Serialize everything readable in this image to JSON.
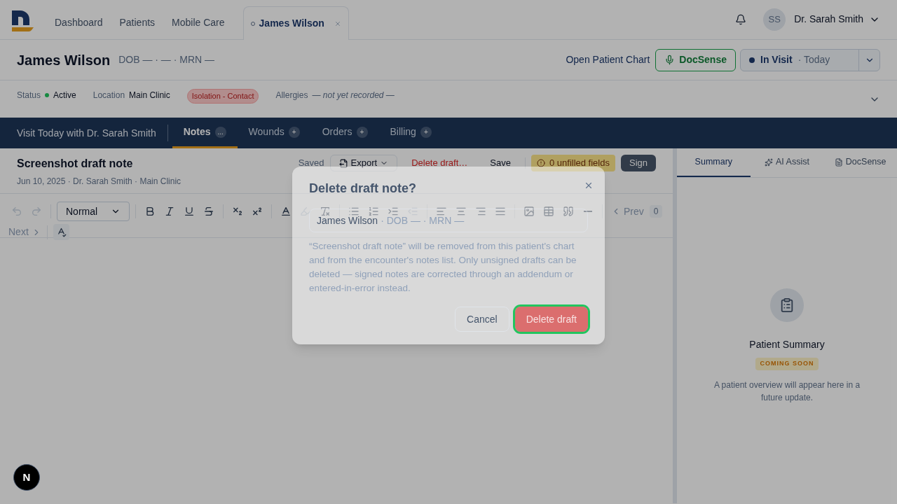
{
  "nav": {
    "tabs": [
      {
        "label": "Dashboard",
        "kind": "link",
        "selected": false
      },
      {
        "label": "Patients",
        "kind": "link",
        "selected": false
      },
      {
        "label": "Mobile Care",
        "kind": "link",
        "selected": false
      },
      {
        "label": "James Wilson",
        "kind": "patient",
        "selected": true
      }
    ],
    "user": {
      "initials": "SS",
      "name": "Dr. Sarah Smith"
    }
  },
  "patient": {
    "name": "James Wilson",
    "meta": "DOB — · — · MRN —",
    "chart_link": "Open Patient Chart",
    "docsense": "DocSense",
    "visit_status": "In Visit",
    "visit_when": "· Today"
  },
  "info": [
    {
      "kind": "status",
      "label": "Status",
      "value": "Active"
    },
    {
      "kind": "text",
      "label": "Location",
      "value": "Main Clinic"
    },
    {
      "kind": "badge",
      "value": "Isolation - Contact"
    },
    {
      "kind": "italic",
      "label": "Allergies",
      "value": "— not yet recorded —"
    }
  ],
  "encounter": {
    "title": "Visit Today with Dr. Sarah Smith",
    "tabs": [
      {
        "label": "Notes",
        "badge": "...",
        "selected": true
      },
      {
        "label": "Wounds",
        "badge": "+",
        "selected": false
      },
      {
        "label": "Orders",
        "badge": "+",
        "selected": false
      },
      {
        "label": "Billing",
        "badge": "+",
        "selected": false
      }
    ]
  },
  "note": {
    "title": "Screenshot draft note",
    "meta": "Jun 10, 2025 · Dr. Sarah Smith · Main Clinic",
    "save_state": "Saved",
    "export": "Export",
    "delete": "Delete draft…",
    "save": "Save",
    "unfilled": "0 unfilled fields",
    "sign": "Sign"
  },
  "toolbar": {
    "style": "Normal",
    "prev": "Prev",
    "count": "0",
    "next": "Next"
  },
  "side_panel": {
    "tabs": [
      {
        "label": "Summary",
        "selected": true
      },
      {
        "label": "AI Assist",
        "selected": false
      },
      {
        "label": "DocSense",
        "selected": false
      }
    ],
    "title": "Patient Summary",
    "badge": "COMING SOON",
    "text": "A patient overview will appear here in a future update."
  },
  "dialog": {
    "title": "Delete draft note?",
    "patient_name": "James Wilson",
    "patient_meta": "· DOB — · MRN —",
    "message": "“Screenshot draft note” will be removed from this patient's chart and from the encounter's notes list. Only unsigned drafts can be deleted — signed notes are corrected through an addendum or entered-in-error instead.",
    "cancel": "Cancel",
    "confirm": "Delete draft",
    "confirm_focused": true
  },
  "dev_badge": "N"
}
